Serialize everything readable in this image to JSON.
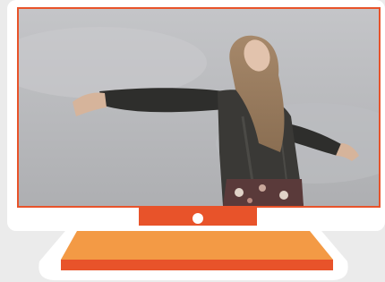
{
  "illustration": {
    "subject": "monitor-with-photo",
    "colors": {
      "frame": "#ffffff",
      "accent": "#e8532a",
      "base_top": "#f39a45",
      "base_bottom": "#e8532a",
      "sky": "#b9babd"
    }
  }
}
